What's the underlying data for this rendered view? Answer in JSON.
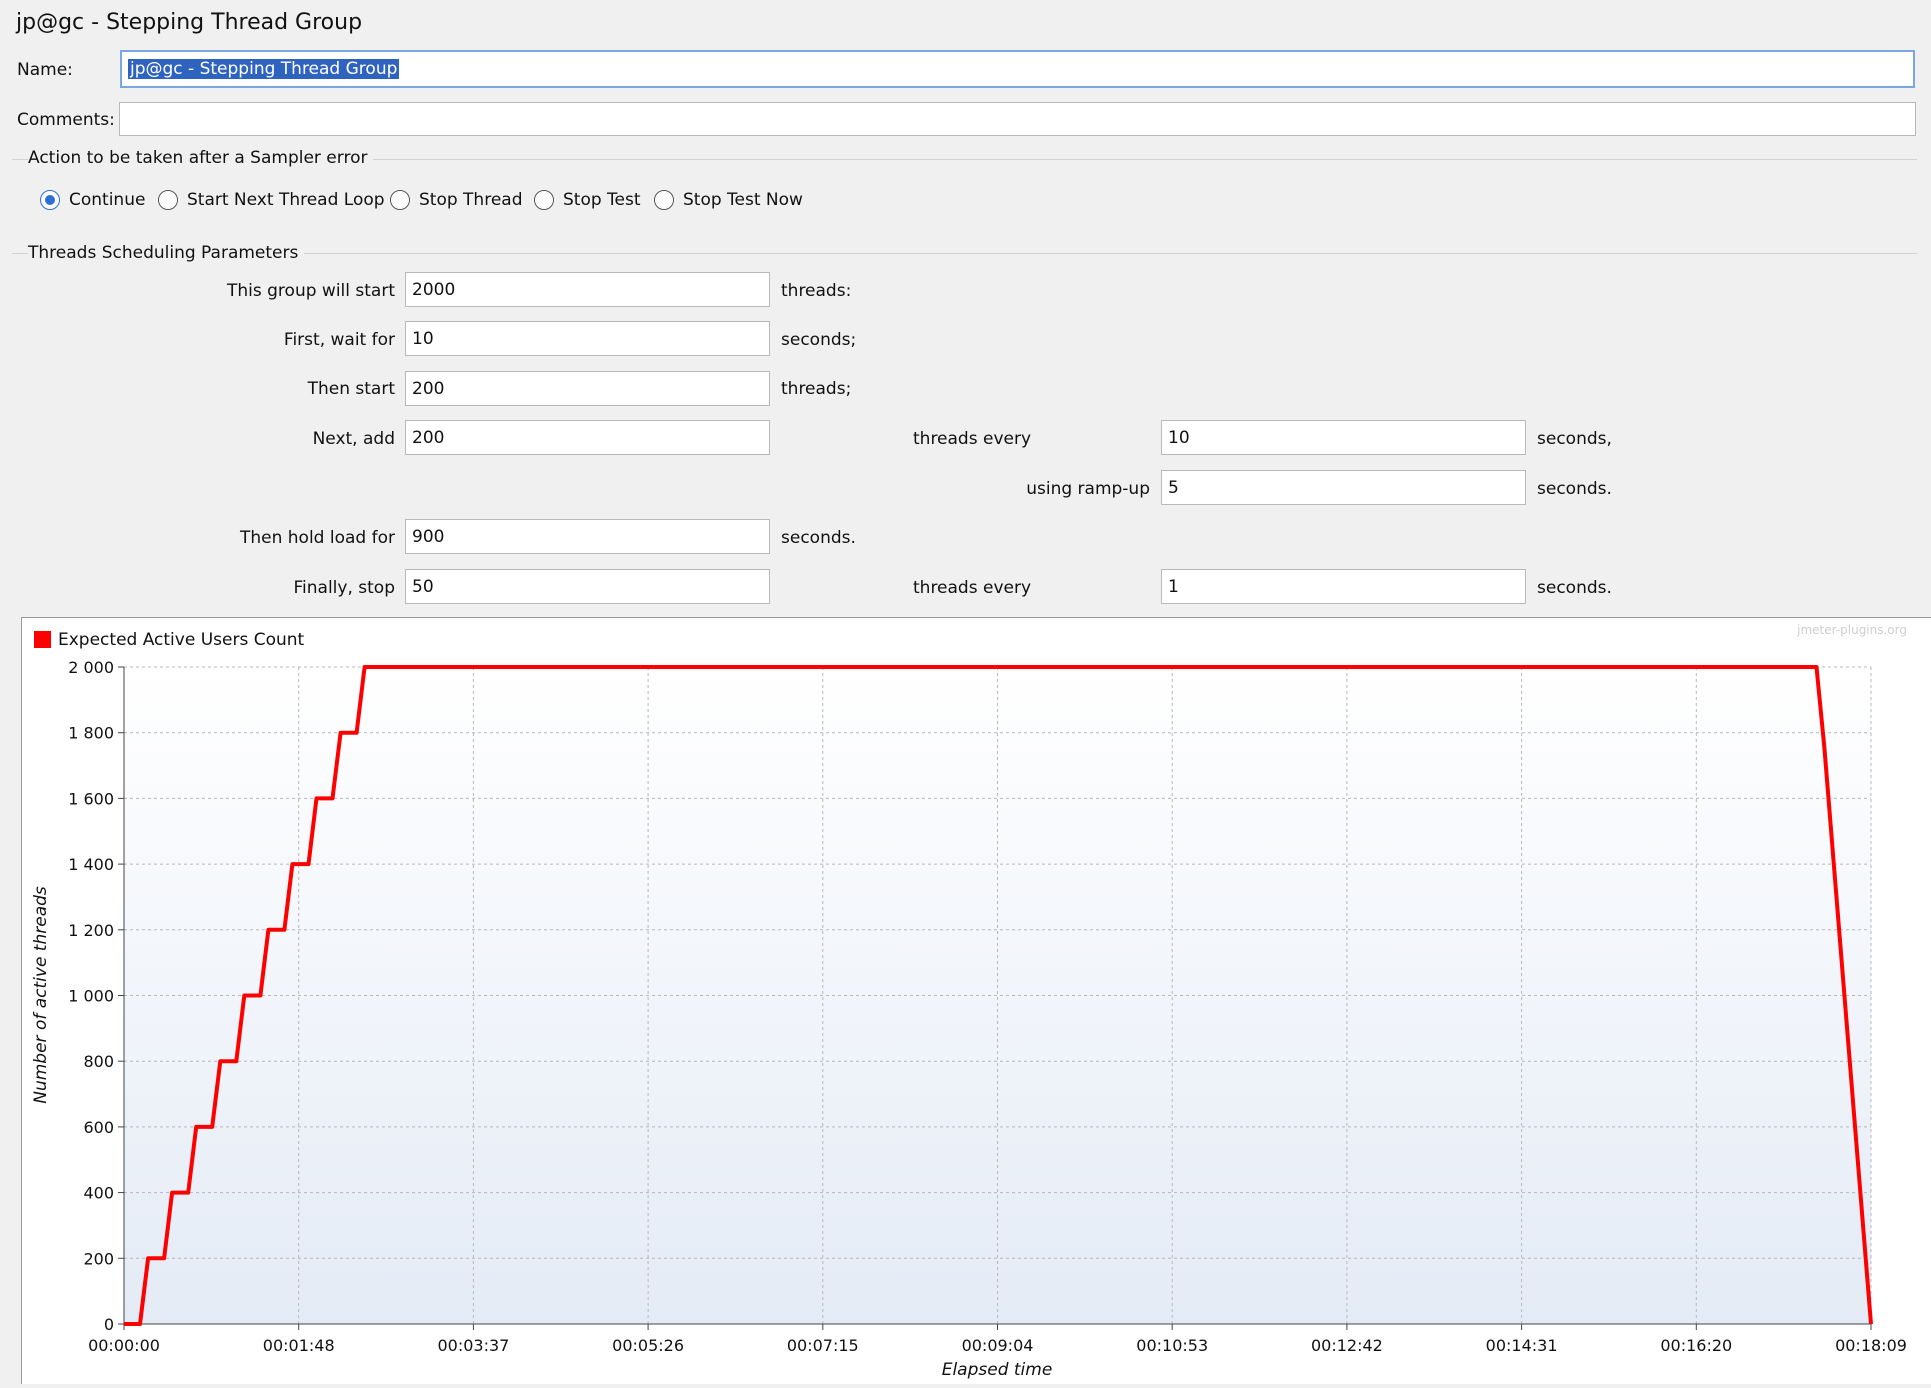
{
  "window": {
    "title": "jp@gc - Stepping Thread Group"
  },
  "form": {
    "name_label": "Name:",
    "name_value": "jp@gc - Stepping Thread Group",
    "comments_label": "Comments:",
    "comments_value": ""
  },
  "sampler_error": {
    "title": "Action to be taken after a Sampler error",
    "options": [
      {
        "label": "Continue",
        "selected": true
      },
      {
        "label": "Start Next Thread Loop",
        "selected": false
      },
      {
        "label": "Stop Thread",
        "selected": false
      },
      {
        "label": "Stop Test",
        "selected": false
      },
      {
        "label": "Stop Test Now",
        "selected": false
      }
    ]
  },
  "scheduling": {
    "title": "Threads Scheduling Parameters",
    "start_threads": {
      "label": "This group will start",
      "value": "2000",
      "unit": "threads:"
    },
    "initial_delay": {
      "label": "First, wait for",
      "value": "10",
      "unit": "seconds;"
    },
    "start_users_count": {
      "label": "Then start",
      "value": "200",
      "unit": "threads;"
    },
    "increment": {
      "label": "Next, add",
      "value": "200",
      "mid": "threads every",
      "value2": "10",
      "unit": "seconds,"
    },
    "rampup": {
      "label": "using ramp-up",
      "value": "5",
      "unit": "seconds."
    },
    "hold": {
      "label": "Then hold load for",
      "value": "900",
      "unit": "seconds."
    },
    "stop": {
      "label": "Finally, stop",
      "value": "50",
      "mid": "threads every",
      "value2": "1",
      "unit": "seconds."
    }
  },
  "chart_data": {
    "type": "line",
    "legend": "Expected Active Users Count",
    "watermark": "jmeter-plugins.org",
    "xlabel": "Elapsed time",
    "ylabel": "Number of active threads",
    "series_color": "#ff0000",
    "grid": true,
    "legend_position": "top-left",
    "xlim": [
      0,
      1089
    ],
    "ylim": [
      0,
      2000
    ],
    "x_ticks": [
      "00:00:00",
      "00:01:48",
      "00:03:37",
      "00:05:26",
      "00:07:15",
      "00:09:04",
      "00:10:53",
      "00:12:42",
      "00:14:31",
      "00:16:20",
      "00:18:09"
    ],
    "y_ticks": [
      "0",
      "200",
      "400",
      "600",
      "800",
      "1 000",
      "1 200",
      "1 400",
      "1 600",
      "1 800",
      "2 000"
    ],
    "y_tick_values": [
      0,
      200,
      400,
      600,
      800,
      1000,
      1200,
      1400,
      1600,
      1800,
      2000
    ],
    "series": [
      {
        "x": [
          0,
          10,
          15,
          25,
          30,
          40,
          45,
          55,
          60,
          70,
          75,
          85,
          90,
          100,
          105,
          115,
          120,
          130,
          135,
          145,
          150,
          155,
          1055,
          1060,
          1089
        ],
        "y": [
          0,
          0,
          200,
          200,
          400,
          400,
          600,
          600,
          800,
          800,
          1000,
          1000,
          1200,
          1200,
          1400,
          1400,
          1600,
          1600,
          1800,
          1800,
          2000,
          2000,
          2000,
          1750,
          0
        ]
      }
    ]
  }
}
